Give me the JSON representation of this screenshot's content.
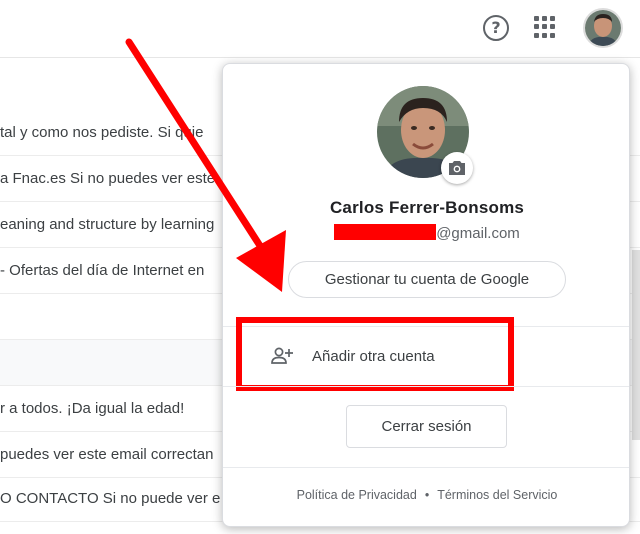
{
  "header": {
    "help_icon": "help-circle-icon",
    "help_glyph": "?",
    "apps_icon": "apps-grid-icon",
    "avatar": "profile-photo"
  },
  "mail_rows": [
    {
      "snippet": "tal y como nos pediste. Si quie",
      "tinted": false
    },
    {
      "snippet": "a Fnac.es Si no puedes ver este",
      "tinted": false
    },
    {
      "snippet": "eaning and structure by learning",
      "tinted": false
    },
    {
      "snippet": "- Ofertas del día de Internet en",
      "tinted": false
    },
    {
      "snippet": "",
      "tinted": false
    },
    {
      "snippet": "",
      "tinted": true
    },
    {
      "snippet": "r a todos. ¡Da igual la edad!",
      "tinted": false
    },
    {
      "snippet": "puedes ver este email correctan",
      "tinted": false
    },
    {
      "snippet": "O CONTACTO Si no puede ver e",
      "tinted": false
    }
  ],
  "account_popup": {
    "name": "Carlos Ferrer-Bonsoms",
    "email_domain": "@gmail.com",
    "manage_account_label": "Gestionar tu cuenta de Google",
    "add_account_label": "Añadir otra cuenta",
    "add_account_icon": "person-add-icon",
    "camera_icon": "camera-icon",
    "sign_out_label": "Cerrar sesión",
    "footer": {
      "privacy": "Política de Privacidad",
      "separator": "•",
      "terms": "Términos del Servicio"
    }
  },
  "annotations": {
    "arrow_color": "#ff0000",
    "highlight_color": "#ff0000",
    "redaction_color": "#ff0000"
  }
}
